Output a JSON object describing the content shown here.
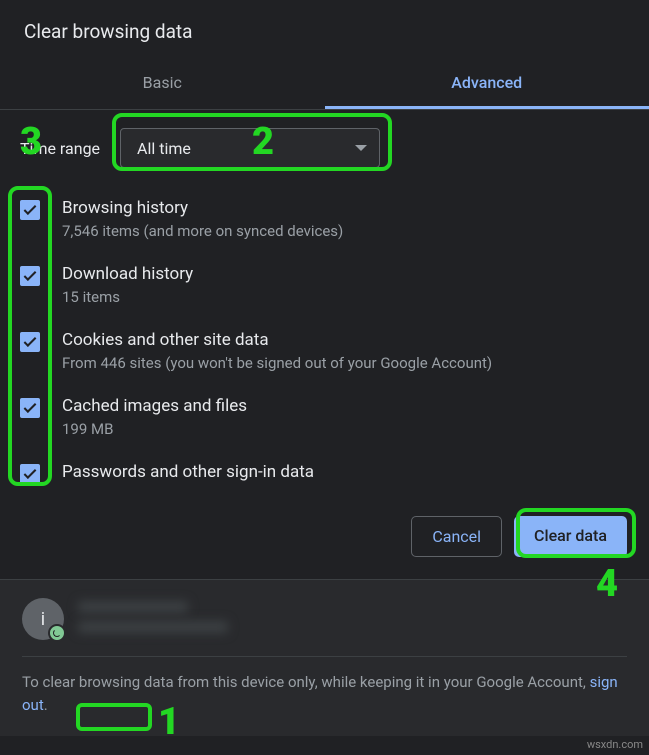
{
  "dialog": {
    "title": "Clear browsing data",
    "tabs": {
      "basic": "Basic",
      "advanced": "Advanced"
    }
  },
  "timeRange": {
    "label": "Time range",
    "selected": "All time"
  },
  "items": [
    {
      "title": "Browsing history",
      "sub": "7,546 items (and more on synced devices)"
    },
    {
      "title": "Download history",
      "sub": "15 items"
    },
    {
      "title": "Cookies and other site data",
      "sub": "From 446 sites (you won't be signed out of your Google Account)"
    },
    {
      "title": "Cached images and files",
      "sub": "199 MB"
    },
    {
      "title": "Passwords and other sign-in data",
      "sub": ""
    }
  ],
  "actions": {
    "cancel": "Cancel",
    "clear": "Clear data"
  },
  "account": {
    "avatarLetter": "i",
    "noteBefore": "To clear browsing data from this device only, while keeping it in your Google Account, ",
    "signOut": "sign out",
    "noteAfter": "."
  },
  "annotations": {
    "n1": "1",
    "n2": "2",
    "n3": "3",
    "n4": "4"
  },
  "watermark": "wsxdn.com"
}
